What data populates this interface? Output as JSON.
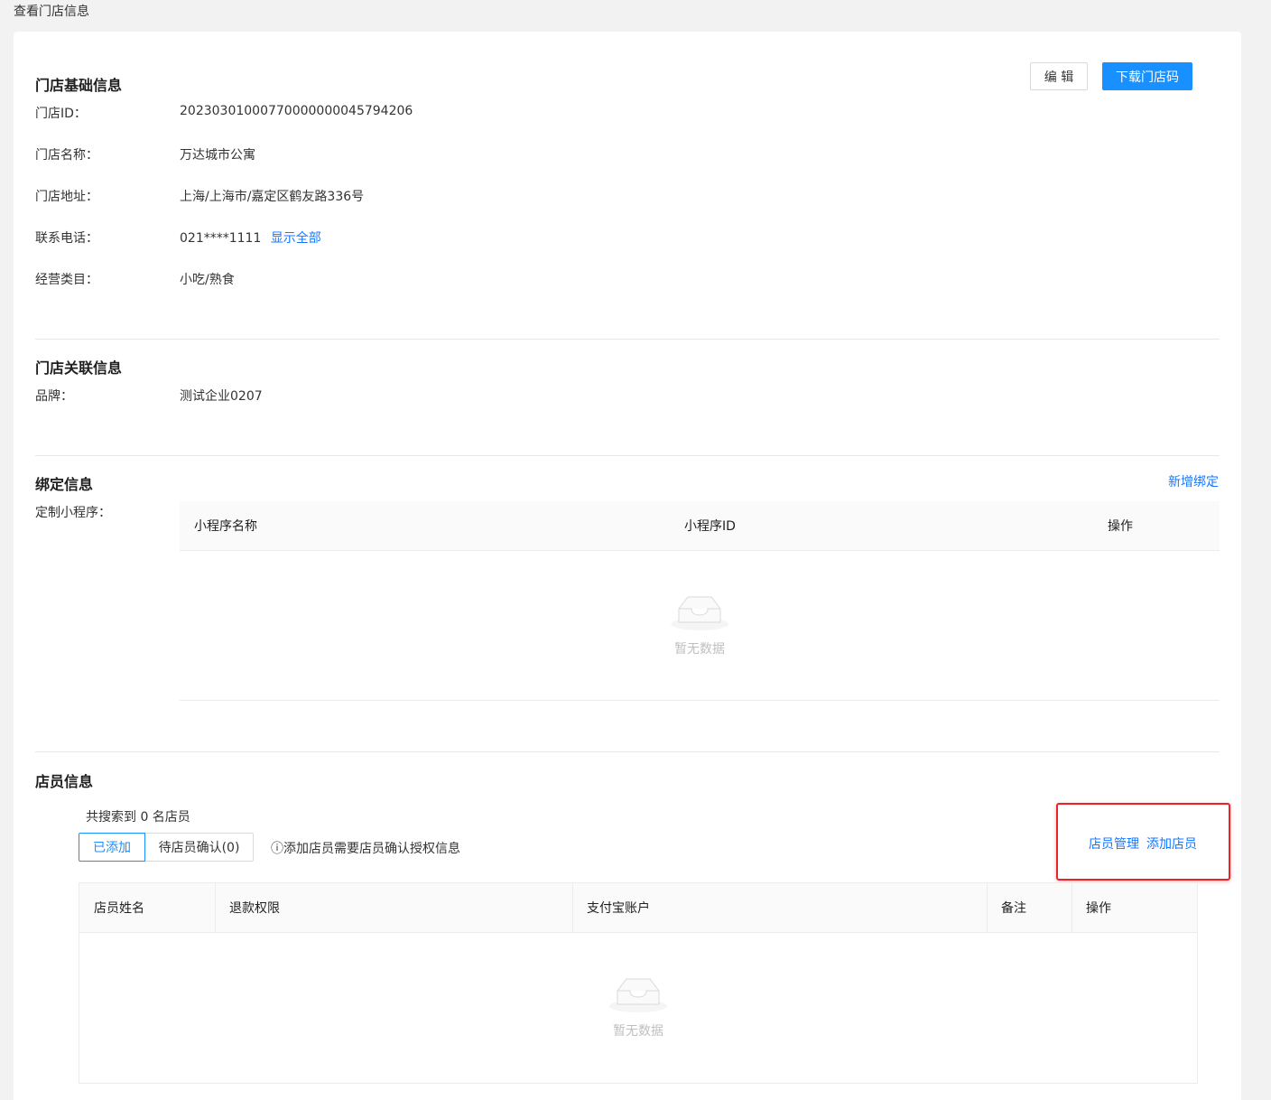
{
  "page_title": "查看门店信息",
  "toolbar": {
    "edit_label": "编 辑",
    "download_label": "下载门店码"
  },
  "basic": {
    "title": "门店基础信息",
    "store_id_label": "门店ID：",
    "store_id": "20230301000770000000045794206",
    "name_label": "门店名称：",
    "name": "万达城市公寓",
    "address_label": "门店地址：",
    "address": "上海/上海市/嘉定区鹤友路336号",
    "phone_label": "联系电话：",
    "phone": "021****1111",
    "show_all": "显示全部",
    "category_label": "经营类目：",
    "category": "小吃/熟食"
  },
  "related": {
    "title": "门店关联信息",
    "brand_label": "品牌：",
    "brand": "测试企业0207"
  },
  "binding": {
    "title": "绑定信息",
    "add_binding": "新增绑定",
    "mini_label": "定制小程序：",
    "columns": [
      "小程序名称",
      "小程序ID",
      "操作"
    ],
    "empty": "暂无数据"
  },
  "staff": {
    "title": "店员信息",
    "count_text": "共搜索到 0 名店员",
    "tabs": [
      "已添加",
      "待店员确认(0)"
    ],
    "notice": "ⓘ添加店员需要店员确认授权信息",
    "manage_label": "店员管理",
    "add_label": "添加店员",
    "columns": [
      "店员姓名",
      "退款权限",
      "支付宝账户",
      "备注",
      "操作"
    ],
    "empty": "暂无数据"
  },
  "colors": {
    "primary": "#1890ff",
    "link": "#1677ff",
    "highlight": "#e8242a"
  }
}
